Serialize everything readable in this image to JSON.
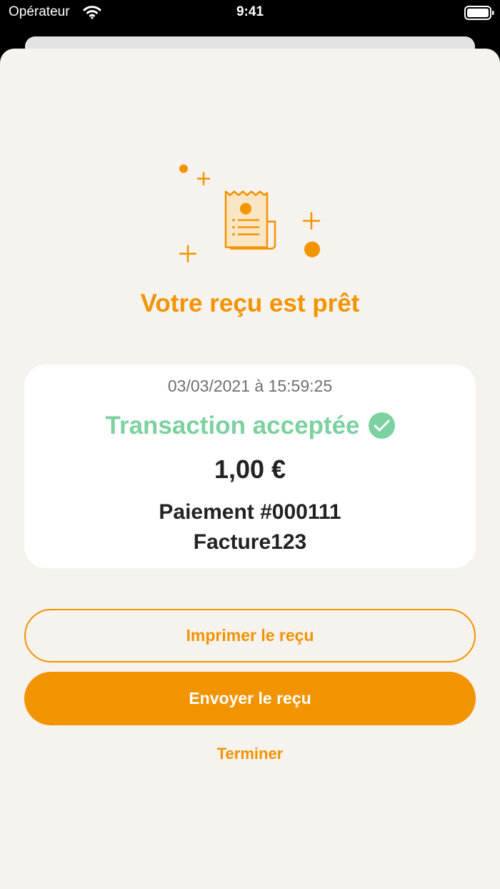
{
  "status_bar": {
    "carrier": "Opérateur",
    "time": "9:41"
  },
  "title": "Votre reçu est prêt",
  "receipt": {
    "date": "03/03/2021 à 15:59:25",
    "status": "Transaction acceptée",
    "amount": "1,00 €",
    "payment": "Paiement #000111",
    "reference": "Facture123"
  },
  "actions": {
    "print_label": "Imprimer le reçu",
    "send_label": "Envoyer le reçu",
    "finish_label": "Terminer"
  },
  "icons": [
    "wifi-icon",
    "battery-icon",
    "receipt-icon",
    "check-icon"
  ],
  "colors": {
    "accent": "#f29300",
    "success": "#7cd1a0",
    "background": "#f6f3ee"
  }
}
